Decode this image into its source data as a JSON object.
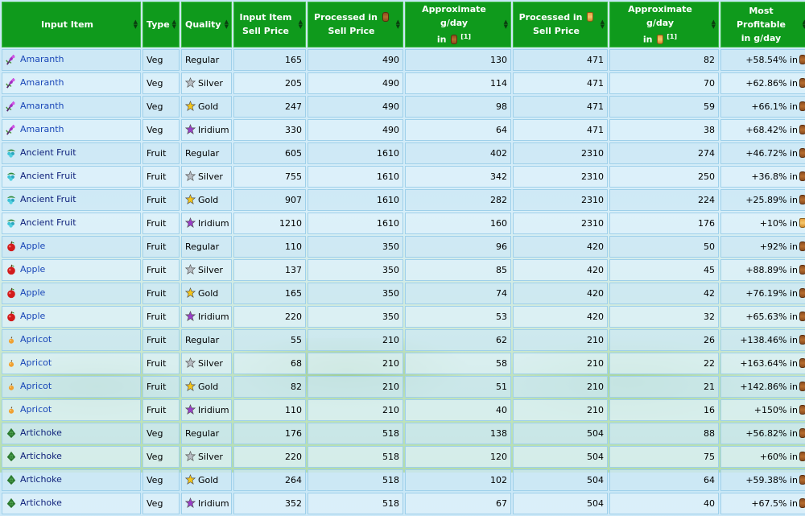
{
  "headers": {
    "input_item": "Input Item",
    "type": "Type",
    "quality": "Quality",
    "sell_line1": "Input Item",
    "sell_line2": "Sell Price",
    "proc_keg_line1": "Processed in",
    "proc_keg_line2": "Sell Price",
    "gday_keg_line1": "Approximate g/day",
    "gday_keg_line2": "in",
    "footnote": "[1]",
    "proc_jar_line1": "Processed in",
    "proc_jar_line2": "Sell Price",
    "gday_jar_line1": "Approximate g/day",
    "gday_jar_line2": "in",
    "most_line1": "Most Profitable",
    "most_line2": "in g/day"
  },
  "rows": [
    {
      "item": "Amaranth",
      "type": "Veg",
      "quality": "Regular",
      "sell": "165",
      "keg": "490",
      "keg_gday": "130",
      "jar": "471",
      "jar_gday": "82",
      "most": "+58.54% in",
      "best": "keg",
      "icon": "amaranth"
    },
    {
      "item": "Amaranth",
      "type": "Veg",
      "quality": "Silver",
      "sell": "205",
      "keg": "490",
      "keg_gday": "114",
      "jar": "471",
      "jar_gday": "70",
      "most": "+62.86% in",
      "best": "keg",
      "icon": "amaranth"
    },
    {
      "item": "Amaranth",
      "type": "Veg",
      "quality": "Gold",
      "sell": "247",
      "keg": "490",
      "keg_gday": "98",
      "jar": "471",
      "jar_gday": "59",
      "most": "+66.1% in",
      "best": "keg",
      "icon": "amaranth"
    },
    {
      "item": "Amaranth",
      "type": "Veg",
      "quality": "Iridium",
      "sell": "330",
      "keg": "490",
      "keg_gday": "64",
      "jar": "471",
      "jar_gday": "38",
      "most": "+68.42% in",
      "best": "keg",
      "icon": "amaranth"
    },
    {
      "item": "Ancient Fruit",
      "type": "Fruit",
      "quality": "Regular",
      "sell": "605",
      "keg": "1610",
      "keg_gday": "402",
      "jar": "2310",
      "jar_gday": "274",
      "most": "+46.72% in",
      "best": "keg",
      "icon": "ancient"
    },
    {
      "item": "Ancient Fruit",
      "type": "Fruit",
      "quality": "Silver",
      "sell": "755",
      "keg": "1610",
      "keg_gday": "342",
      "jar": "2310",
      "jar_gday": "250",
      "most": "+36.8% in",
      "best": "keg",
      "icon": "ancient"
    },
    {
      "item": "Ancient Fruit",
      "type": "Fruit",
      "quality": "Gold",
      "sell": "907",
      "keg": "1610",
      "keg_gday": "282",
      "jar": "2310",
      "jar_gday": "224",
      "most": "+25.89% in",
      "best": "keg",
      "icon": "ancient"
    },
    {
      "item": "Ancient Fruit",
      "type": "Fruit",
      "quality": "Iridium",
      "sell": "1210",
      "keg": "1610",
      "keg_gday": "160",
      "jar": "2310",
      "jar_gday": "176",
      "most": "+10% in",
      "best": "jar",
      "icon": "ancient"
    },
    {
      "item": "Apple",
      "type": "Fruit",
      "quality": "Regular",
      "sell": "110",
      "keg": "350",
      "keg_gday": "96",
      "jar": "420",
      "jar_gday": "50",
      "most": "+92% in",
      "best": "keg",
      "icon": "apple"
    },
    {
      "item": "Apple",
      "type": "Fruit",
      "quality": "Silver",
      "sell": "137",
      "keg": "350",
      "keg_gday": "85",
      "jar": "420",
      "jar_gday": "45",
      "most": "+88.89% in",
      "best": "keg",
      "icon": "apple"
    },
    {
      "item": "Apple",
      "type": "Fruit",
      "quality": "Gold",
      "sell": "165",
      "keg": "350",
      "keg_gday": "74",
      "jar": "420",
      "jar_gday": "42",
      "most": "+76.19% in",
      "best": "keg",
      "icon": "apple"
    },
    {
      "item": "Apple",
      "type": "Fruit",
      "quality": "Iridium",
      "sell": "220",
      "keg": "350",
      "keg_gday": "53",
      "jar": "420",
      "jar_gday": "32",
      "most": "+65.63% in",
      "best": "keg",
      "icon": "apple"
    },
    {
      "item": "Apricot",
      "type": "Fruit",
      "quality": "Regular",
      "sell": "55",
      "keg": "210",
      "keg_gday": "62",
      "jar": "210",
      "jar_gday": "26",
      "most": "+138.46% in",
      "best": "keg",
      "icon": "apricot"
    },
    {
      "item": "Apricot",
      "type": "Fruit",
      "quality": "Silver",
      "sell": "68",
      "keg": "210",
      "keg_gday": "58",
      "jar": "210",
      "jar_gday": "22",
      "most": "+163.64% in",
      "best": "keg",
      "icon": "apricot"
    },
    {
      "item": "Apricot",
      "type": "Fruit",
      "quality": "Gold",
      "sell": "82",
      "keg": "210",
      "keg_gday": "51",
      "jar": "210",
      "jar_gday": "21",
      "most": "+142.86% in",
      "best": "keg",
      "icon": "apricot"
    },
    {
      "item": "Apricot",
      "type": "Fruit",
      "quality": "Iridium",
      "sell": "110",
      "keg": "210",
      "keg_gday": "40",
      "jar": "210",
      "jar_gday": "16",
      "most": "+150% in",
      "best": "keg",
      "icon": "apricot"
    },
    {
      "item": "Artichoke",
      "type": "Veg",
      "quality": "Regular",
      "sell": "176",
      "keg": "518",
      "keg_gday": "138",
      "jar": "504",
      "jar_gday": "88",
      "most": "+56.82% in",
      "best": "keg",
      "icon": "artichoke"
    },
    {
      "item": "Artichoke",
      "type": "Veg",
      "quality": "Silver",
      "sell": "220",
      "keg": "518",
      "keg_gday": "120",
      "jar": "504",
      "jar_gday": "75",
      "most": "+60% in",
      "best": "keg",
      "icon": "artichoke"
    },
    {
      "item": "Artichoke",
      "type": "Veg",
      "quality": "Gold",
      "sell": "264",
      "keg": "518",
      "keg_gday": "102",
      "jar": "504",
      "jar_gday": "64",
      "most": "+59.38% in",
      "best": "keg",
      "icon": "artichoke"
    },
    {
      "item": "Artichoke",
      "type": "Veg",
      "quality": "Iridium",
      "sell": "352",
      "keg": "518",
      "keg_gday": "67",
      "jar": "504",
      "jar_gday": "40",
      "most": "+67.5% in",
      "best": "keg",
      "icon": "artichoke"
    }
  ],
  "colors": {
    "header_green": "#0f9a1c",
    "link_blue": "#1a47b8",
    "star_silver": "#b8bcc2",
    "star_gold": "#f5c518",
    "star_iridium": "#9a3ec9"
  }
}
